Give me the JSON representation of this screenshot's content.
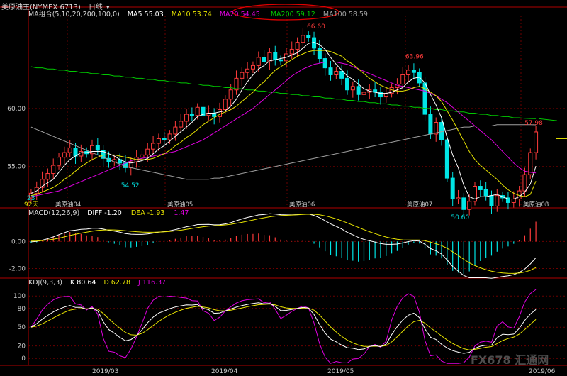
{
  "title": "美原油主(NYMEX 6713)",
  "period": "日线",
  "colors": {
    "up": "#ff3b3b",
    "down": "#00e5e5",
    "ma5": "#ffffff",
    "ma10": "#e8e400",
    "ma20": "#e000e0",
    "ma200": "#00c800",
    "ma100": "#a0a0a0",
    "grid": "#6b0000",
    "axis": "#b00000",
    "text": "#c8c8c8",
    "ellipse": "#e00000"
  },
  "ma_header": {
    "label": "MA组合(5,10,20,200,100,0)",
    "ma5": "MA5 55.03",
    "ma10": "MA10 53.74",
    "ma20": "MA20 54.45",
    "ma200": "MA200 59.12",
    "ma100": "MA100 58.59"
  },
  "macd_header": {
    "label": "MACD(12,26,9)",
    "diff": "DIFF -1.20",
    "dea": "DEA -1.93",
    "macd": "1.47"
  },
  "kdj_header": {
    "label": "KDJ(9,3,3)",
    "k": "K 80.64",
    "d": "D 62.78",
    "j": "J 116.37"
  },
  "annotations": {
    "high1": "66.60",
    "high2": "63.96",
    "low1": "54.52",
    "low2": "50.60",
    "last": "57.98",
    "left_edge": "23",
    "days": "92天"
  },
  "contract_labels": [
    "美原油04",
    "美原油05",
    "美原油06",
    "美原油07",
    "美原油08"
  ],
  "month_labels": [
    "2019/03",
    "2019/04",
    "2019/05",
    "2019/06"
  ],
  "watermark": "FX678 汇通网",
  "chart_data": {
    "type": "candlestick",
    "price_axis": {
      "ticks": [
        60.0,
        55.0
      ],
      "labels": [
        "60.00",
        "55.00"
      ],
      "range": [
        51.5,
        68
      ]
    },
    "macd_axis": {
      "ticks": [
        0,
        -2
      ],
      "labels": [
        "0.00",
        "-2.00"
      ],
      "range": [
        -2.6,
        1.8
      ]
    },
    "kdj_axis": {
      "ticks": [
        100,
        80,
        50,
        20,
        0
      ],
      "labels": [
        "100",
        "80",
        "50",
        "20",
        "0"
      ],
      "range": [
        -10,
        115
      ]
    },
    "close": [
      52.7,
      53.2,
      53.9,
      54.4,
      55.1,
      55.8,
      56.2,
      56.6,
      55.9,
      56.3,
      56.1,
      56.8,
      56.4,
      55.7,
      55.4,
      55.6,
      55.3,
      54.9,
      55.4,
      55.8,
      56.0,
      56.5,
      57.0,
      57.4,
      57.3,
      57.8,
      58.4,
      58.9,
      59.5,
      59.4,
      60.1,
      59.4,
      59.6,
      59.3,
      59.9,
      60.8,
      61.6,
      62.6,
      63.1,
      63.4,
      63.7,
      64.4,
      64.0,
      64.8,
      64.2,
      64.1,
      64.7,
      65.1,
      65.7,
      66.3,
      66.1,
      65.2,
      64.3,
      63.5,
      62.9,
      63.2,
      62.6,
      61.6,
      61.9,
      61.2,
      61.4,
      61.6,
      61.4,
      61.0,
      61.3,
      61.8,
      62.1,
      62.9,
      63.3,
      63.1,
      62.2,
      59.5,
      57.8,
      58.8,
      57.3,
      54.0,
      52.2,
      52.3,
      51.3,
      52.0,
      53.3,
      53.0,
      52.5,
      51.6,
      52.5,
      52.3,
      51.9,
      52.2,
      52.9,
      54.3,
      56.2,
      57.98
    ],
    "open": [
      52.3,
      52.7,
      53.2,
      53.9,
      54.4,
      55.1,
      55.8,
      56.2,
      56.6,
      55.9,
      56.3,
      56.1,
      56.8,
      56.4,
      55.7,
      55.4,
      55.6,
      55.3,
      54.9,
      55.4,
      55.8,
      56.0,
      56.5,
      57.0,
      57.4,
      57.3,
      57.8,
      58.4,
      58.9,
      59.5,
      59.4,
      60.1,
      59.4,
      59.6,
      59.3,
      59.9,
      60.8,
      61.6,
      62.6,
      63.1,
      63.4,
      63.7,
      64.4,
      64.0,
      64.8,
      64.2,
      64.1,
      64.7,
      65.1,
      65.7,
      66.3,
      66.1,
      65.2,
      64.3,
      63.5,
      62.9,
      63.2,
      62.6,
      61.6,
      61.9,
      61.2,
      61.4,
      61.6,
      61.4,
      61.0,
      61.3,
      61.8,
      62.1,
      62.9,
      63.3,
      63.1,
      62.2,
      59.5,
      57.8,
      58.8,
      57.3,
      54.0,
      52.2,
      52.3,
      51.3,
      52.0,
      53.3,
      53.0,
      52.5,
      51.6,
      52.5,
      52.3,
      51.9,
      52.2,
      52.9,
      54.3,
      56.2
    ],
    "ma5": [
      52.7,
      52.9,
      53.3,
      53.6,
      53.9,
      54.5,
      55.1,
      55.6,
      55.9,
      56.2,
      56.2,
      56.3,
      56.3,
      56.3,
      56.1,
      55.9,
      55.6,
      55.4,
      55.3,
      55.4,
      55.5,
      55.7,
      56.1,
      56.5,
      56.8,
      57.2,
      57.6,
      58.0,
      58.4,
      58.8,
      59.3,
      59.5,
      59.6,
      59.6,
      59.7,
      59.8,
      60.2,
      60.8,
      61.6,
      62.3,
      62.9,
      63.4,
      63.7,
      64.1,
      64.2,
      64.3,
      64.4,
      64.6,
      64.8,
      65.2,
      65.6,
      65.7,
      65.5,
      65.1,
      64.4,
      63.8,
      63.3,
      62.8,
      62.5,
      62.1,
      61.7,
      61.5,
      61.4,
      61.3,
      61.3,
      61.4,
      61.6,
      61.8,
      62.3,
      62.6,
      62.7,
      62.2,
      61.2,
      60.3,
      59.2,
      57.5,
      56.0,
      54.9,
      53.4,
      52.4,
      52.2,
      52.4,
      52.4,
      52.5,
      52.6,
      52.4,
      52.2,
      52.2,
      52.4,
      52.8,
      53.5,
      55.03
    ],
    "ma10": [
      52.5,
      52.6,
      52.8,
      53.0,
      53.2,
      53.5,
      53.9,
      54.2,
      54.6,
      55.0,
      55.3,
      55.6,
      55.8,
      56.0,
      56.0,
      56.0,
      55.9,
      55.8,
      55.7,
      55.6,
      55.6,
      55.6,
      55.7,
      55.9,
      56.1,
      56.4,
      56.8,
      57.1,
      57.5,
      57.8,
      58.2,
      58.6,
      58.9,
      59.2,
      59.5,
      59.7,
      59.9,
      60.2,
      60.6,
      61.0,
      61.4,
      61.9,
      62.3,
      62.8,
      63.3,
      63.6,
      63.9,
      64.2,
      64.5,
      64.7,
      64.9,
      65.0,
      65.0,
      65.0,
      64.9,
      64.7,
      64.5,
      64.1,
      63.8,
      63.4,
      63.0,
      62.6,
      62.3,
      62.0,
      61.8,
      61.6,
      61.5,
      61.5,
      61.6,
      61.8,
      61.9,
      61.7,
      61.4,
      61.1,
      60.6,
      59.8,
      59.0,
      58.1,
      57.2,
      56.3,
      55.6,
      55.1,
      54.7,
      54.3,
      53.9,
      53.4,
      53.0,
      52.7,
      52.5,
      52.4,
      52.6,
      53.74
    ],
    "ma20": [
      52.4,
      52.5,
      52.6,
      52.7,
      52.8,
      52.9,
      53.1,
      53.3,
      53.5,
      53.7,
      53.9,
      54.1,
      54.3,
      54.5,
      54.7,
      54.9,
      55.1,
      55.3,
      55.5,
      55.6,
      55.7,
      55.8,
      55.9,
      56.0,
      56.1,
      56.2,
      56.3,
      56.5,
      56.7,
      56.9,
      57.1,
      57.3,
      57.6,
      57.9,
      58.2,
      58.5,
      58.8,
      59.1,
      59.4,
      59.7,
      60.0,
      60.4,
      60.8,
      61.2,
      61.6,
      62.0,
      62.4,
      62.8,
      63.1,
      63.4,
      63.6,
      63.8,
      63.9,
      64.0,
      64.0,
      64.0,
      63.9,
      63.8,
      63.6,
      63.4,
      63.2,
      63.0,
      62.8,
      62.6,
      62.4,
      62.2,
      62.0,
      61.9,
      61.8,
      61.7,
      61.6,
      61.5,
      61.3,
      61.1,
      60.8,
      60.5,
      60.1,
      59.7,
      59.3,
      58.9,
      58.5,
      58.1,
      57.7,
      57.3,
      56.8,
      56.3,
      55.8,
      55.3,
      54.9,
      54.6,
      54.5,
      54.45
    ],
    "ma200": [
      63.6,
      63.5,
      63.5,
      63.4,
      63.4,
      63.3,
      63.3,
      63.2,
      63.2,
      63.1,
      63.1,
      63.0,
      63.0,
      62.9,
      62.9,
      62.8,
      62.8,
      62.7,
      62.7,
      62.6,
      62.6,
      62.5,
      62.5,
      62.4,
      62.4,
      62.3,
      62.3,
      62.2,
      62.2,
      62.1,
      62.1,
      62.0,
      62.0,
      61.9,
      61.9,
      61.8,
      61.8,
      61.7,
      61.7,
      61.6,
      61.6,
      61.5,
      61.5,
      61.4,
      61.4,
      61.3,
      61.3,
      61.2,
      61.2,
      61.1,
      61.1,
      61.0,
      61.0,
      60.9,
      60.9,
      60.8,
      60.8,
      60.7,
      60.7,
      60.6,
      60.6,
      60.5,
      60.5,
      60.4,
      60.4,
      60.3,
      60.3,
      60.2,
      60.2,
      60.1,
      60.1,
      60.0,
      60.0,
      59.9,
      59.9,
      59.8,
      59.8,
      59.7,
      59.7,
      59.6,
      59.6,
      59.5,
      59.5,
      59.4,
      59.4,
      59.3,
      59.3,
      59.2,
      59.2,
      59.15,
      59.13,
      59.12
    ],
    "ma100": [
      58.4,
      58.2,
      58.0,
      57.8,
      57.6,
      57.4,
      57.2,
      57.0,
      56.8,
      56.6,
      56.4,
      56.2,
      56.0,
      55.8,
      55.6,
      55.4,
      55.2,
      55.0,
      54.9,
      54.8,
      54.7,
      54.6,
      54.5,
      54.4,
      54.3,
      54.2,
      54.1,
      54.0,
      53.9,
      53.9,
      53.9,
      53.9,
      53.9,
      54.0,
      54.0,
      54.1,
      54.2,
      54.3,
      54.4,
      54.5,
      54.6,
      54.7,
      54.8,
      54.9,
      55.0,
      55.1,
      55.2,
      55.3,
      55.4,
      55.5,
      55.6,
      55.7,
      55.8,
      55.9,
      56.0,
      56.1,
      56.2,
      56.3,
      56.4,
      56.5,
      56.6,
      56.7,
      56.8,
      56.9,
      57.0,
      57.1,
      57.2,
      57.3,
      57.4,
      57.5,
      57.6,
      57.7,
      57.8,
      57.9,
      58.0,
      58.1,
      58.2,
      58.3,
      58.4,
      58.4,
      58.5,
      58.5,
      58.5,
      58.5,
      58.6,
      58.6,
      58.6,
      58.6,
      58.6,
      58.6,
      58.6,
      58.59
    ]
  }
}
